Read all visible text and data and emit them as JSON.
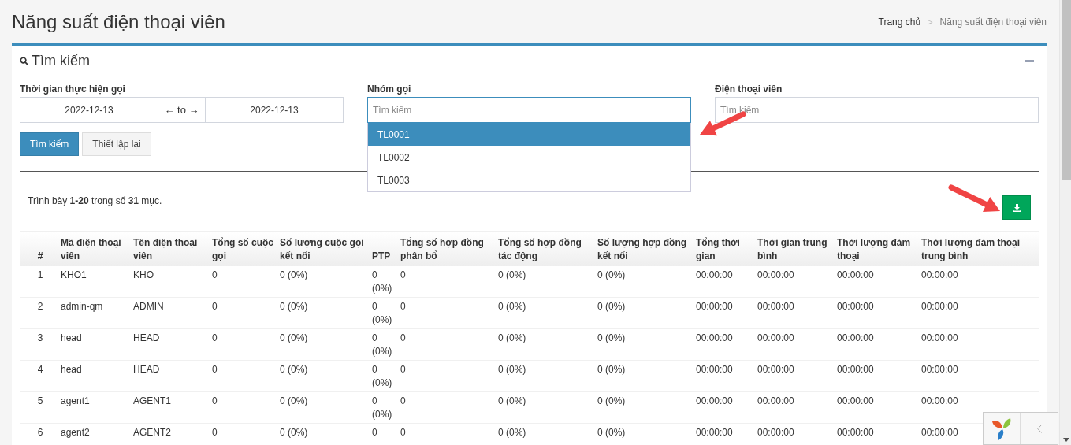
{
  "title": "Năng suất điện thoại viên",
  "breadcrumb": [
    {
      "label": "Trang chủ"
    },
    {
      "label": "Năng suất điện thoại viên"
    }
  ],
  "breadcrumb_separator": ">",
  "search_panel": {
    "title": "Tìm kiếm",
    "expanded": true,
    "fields": [
      {
        "kind": "daterange",
        "label": "Thời gian thực hiện gọi",
        "from": "2022-12-13",
        "separator": "← to →",
        "to": "2022-12-13"
      },
      {
        "kind": "select",
        "label": "Nhóm gọi",
        "placeholder": "Tìm kiếm",
        "options": [
          {
            "label": "TL0001",
            "selected": true
          },
          {
            "label": "TL0002",
            "selected": false
          },
          {
            "label": "TL0003",
            "selected": false
          }
        ]
      },
      {
        "kind": "text",
        "label": "Điện thoại viên",
        "placeholder": "Tìm kiếm"
      }
    ],
    "buttons": [
      {
        "kind": "primary",
        "label": "Tìm kiếm"
      },
      {
        "kind": "default",
        "label": "Thiết lập lại"
      }
    ]
  },
  "summary": "Trình bày **1-20** trong số **31** mục.",
  "table": {
    "columns": [
      "#",
      "Mã điện thoại viên",
      "Tên điện thoại viên",
      "Tổng số cuộc gọi",
      "Số lượng cuộc gọi kết nối",
      "PTP",
      "Tổng số hợp đồng phân bổ",
      "Tổng số hợp đồng tác động",
      "Số lượng hợp đồng kết nối",
      "Tổng thời gian",
      "Thời gian trung bình",
      "Thời lượng đàm thoại",
      "Thời lượng đàm thoại trung bình"
    ],
    "rows": [
      [
        "1",
        "KHO1",
        "KHO",
        "0",
        "0 (0%)",
        "0 (0%)",
        "0",
        "0 (0%)",
        "0 (0%)",
        "00:00:00",
        "00:00:00",
        "00:00:00",
        "00:00:00"
      ],
      [
        "2",
        "admin-qm",
        "ADMIN",
        "0",
        "0 (0%)",
        "0 (0%)",
        "0",
        "0 (0%)",
        "0 (0%)",
        "00:00:00",
        "00:00:00",
        "00:00:00",
        "00:00:00"
      ],
      [
        "3",
        "head",
        "HEAD",
        "0",
        "0 (0%)",
        "0 (0%)",
        "0",
        "0 (0%)",
        "0 (0%)",
        "00:00:00",
        "00:00:00",
        "00:00:00",
        "00:00:00"
      ],
      [
        "4",
        "head",
        "HEAD",
        "0",
        "0 (0%)",
        "0 (0%)",
        "0",
        "0 (0%)",
        "0 (0%)",
        "00:00:00",
        "00:00:00",
        "00:00:00",
        "00:00:00"
      ],
      [
        "5",
        "agent1",
        "AGENT1",
        "0",
        "0 (0%)",
        "0 (0%)",
        "0",
        "0 (0%)",
        "0 (0%)",
        "00:00:00",
        "00:00:00",
        "00:00:00",
        "00:00:00"
      ],
      [
        "6",
        "agent2",
        "AGENT2",
        "0",
        "0 (0%)",
        "0",
        "0",
        "0 (0%)",
        "0 (0%)",
        "00:00:00",
        "00:00:00",
        "00:00:00",
        "00:00:00"
      ]
    ]
  }
}
